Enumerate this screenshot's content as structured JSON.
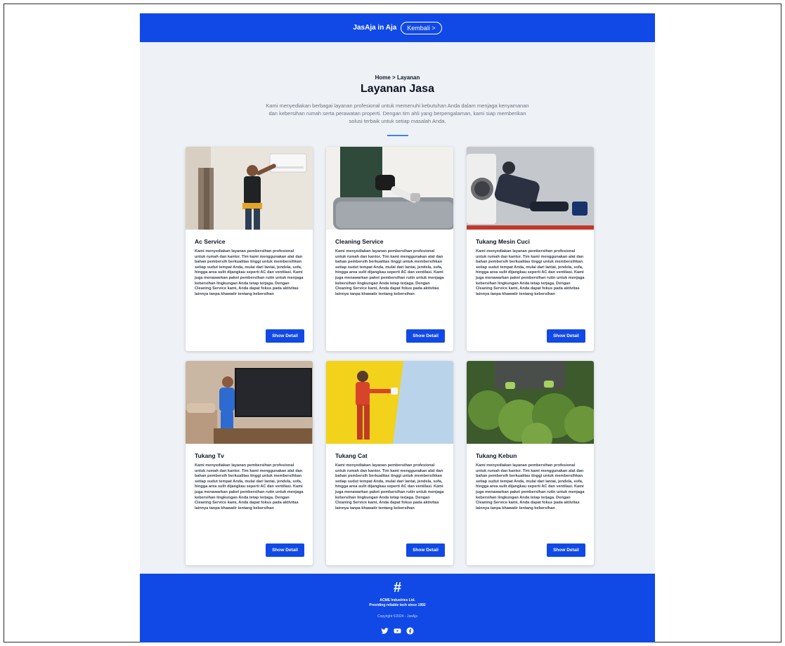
{
  "header": {
    "brand": "JasAja in Aja",
    "back_label": "Kembali >"
  },
  "hero": {
    "breadcrumb": "Home > Layanan",
    "title": "Layanan Jasa",
    "intro": "Kami menyediakan berbagai layanan profesional untuk memenuhi kebutuhan Anda dalam menjaga kenyamanan dan kebersihan rumah serta perawatan properti. Dengan tim ahli yang berpengalaman, kami siap memberikan solusi terbaik untuk setiap masalah Anda."
  },
  "services": [
    {
      "title": "Ac Service",
      "description": "Kami menyediakan layanan pembersihan profesional untuk rumah dan kantor. Tim kami menggunakan alat dan bahan pembersih berkualitas tinggi untuk membersihkan setiap sudut tempat Anda, mulai dari lantai, jendela, sofa, hingga area sulit dijangkau seperti AC dan ventilasi. Kami juga menawarkan paket pembersihan rutin untuk menjaga kebersihan lingkungan Anda tetap terjaga. Dengan Cleaning Service kami, Anda dapat fokus pada aktivitas lainnya tanpa khawatir tentang kebersihan",
      "button": "Show Detail"
    },
    {
      "title": "Cleaning Service",
      "description": "Kami menyediakan layanan pembersihan profesional untuk rumah dan kantor. Tim kami menggunakan alat dan bahan pembersih berkualitas tinggi untuk membersihkan setiap sudut tempat Anda, mulai dari lantai, jendela, sofa, hingga area sulit dijangkau seperti AC dan ventilasi. Kami juga menawarkan paket pembersihan rutin untuk menjaga kebersihan lingkungan Anda tetap terjaga. Dengan Cleaning Service kami, Anda dapat fokus pada aktivitas lainnya tanpa khawatir tentang kebersihan",
      "button": "Show Detail"
    },
    {
      "title": "Tukang Mesin Cuci",
      "description": "Kami menyediakan layanan pembersihan profesional untuk rumah dan kantor. Tim kami menggunakan alat dan bahan pembersih berkualitas tinggi untuk membersihkan setiap sudut tempat Anda, mulai dari lantai, jendela, sofa, hingga area sulit dijangkau seperti AC dan ventilasi. Kami juga menawarkan paket pembersihan rutin untuk menjaga kebersihan lingkungan Anda tetap terjaga. Dengan Cleaning Service kami, Anda dapat fokus pada aktivitas lainnya tanpa khawatir tentang kebersihan",
      "button": "Show Detail"
    },
    {
      "title": "Tukang Tv",
      "description": "Kami menyediakan layanan pembersihan profesional untuk rumah dan kantor. Tim kami menggunakan alat dan bahan pembersih berkualitas tinggi untuk membersihkan setiap sudut tempat Anda, mulai dari lantai, jendela, sofa, hingga area sulit dijangkau seperti AC dan ventilasi. Kami juga menawarkan paket pembersihan rutin untuk menjaga kebersihan lingkungan Anda tetap terjaga. Dengan Cleaning Service kami, Anda dapat fokus pada aktivitas lainnya tanpa khawatir tentang kebersihan",
      "button": "Show Detail"
    },
    {
      "title": "Tukang Cat",
      "description": "Kami menyediakan layanan pembersihan profesional untuk rumah dan kantor. Tim kami menggunakan alat dan bahan pembersih berkualitas tinggi untuk membersihkan setiap sudut tempat Anda, mulai dari lantai, jendela, sofa, hingga area sulit dijangkau seperti AC dan ventilasi. Kami juga menawarkan paket pembersihan rutin untuk menjaga kebersihan lingkungan Anda tetap terjaga. Dengan Cleaning Service kami, Anda dapat fokus pada aktivitas lainnya tanpa khawatir tentang kebersihan",
      "button": "Show Detail"
    },
    {
      "title": "Tukang Kebun",
      "description": "Kami menyediakan layanan pembersihan profesional untuk rumah dan kantor. Tim kami menggunakan alat dan bahan pembersih berkualitas tinggi untuk membersihkan setiap sudut tempat Anda, mulai dari lantai, jendela, sofa, hingga area sulit dijangkau seperti AC dan ventilasi. Kami juga menawarkan paket pembersihan rutin untuk menjaga kebersihan lingkungan Anda tetap terjaga. Dengan Cleaning Service kami, Anda dapat fokus pada aktivitas lainnya tanpa khawatir tentang kebersihan",
      "button": "Show Detail"
    }
  ],
  "footer": {
    "logo_glyph": "#",
    "company": "ACME Industries Ltd.",
    "tagline": "Providing reliable tech since 1992",
    "copyright": "Copyright ©2024 - JasAja",
    "socials": [
      "twitter-icon",
      "youtube-icon",
      "facebook-icon"
    ]
  },
  "colors": {
    "primary": "#1149e6",
    "background": "#eef2f6",
    "accent_divider": "#3b82f6"
  }
}
